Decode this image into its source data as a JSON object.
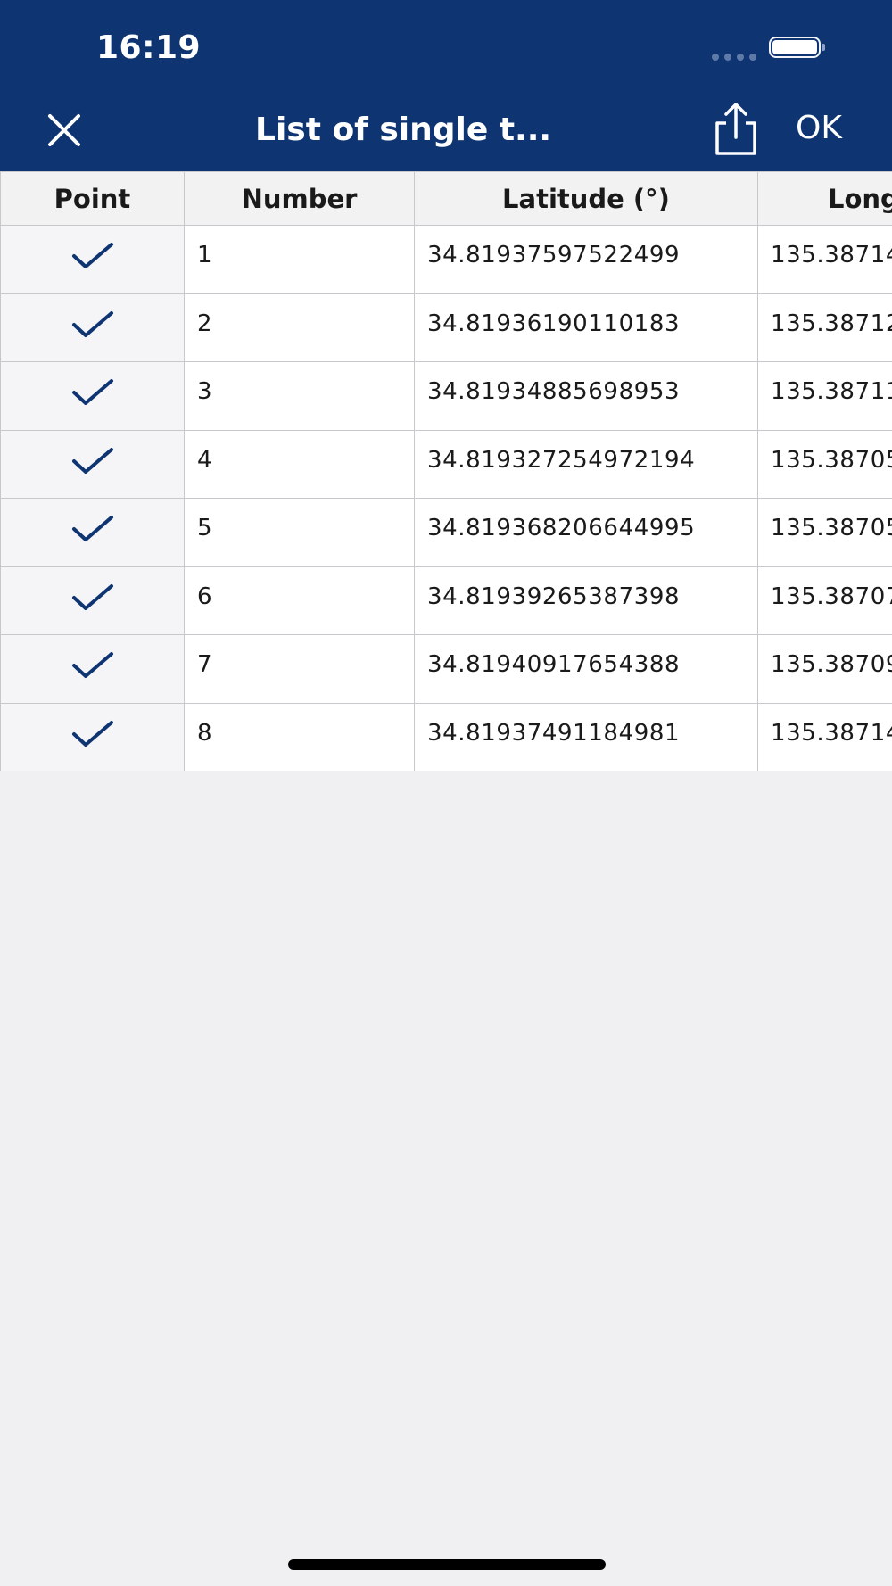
{
  "status_bar": {
    "time": "16:19"
  },
  "nav": {
    "title": "List of single t...",
    "ok_label": "OK",
    "close_icon": "close-icon",
    "share_icon": "share-icon"
  },
  "table": {
    "headers": {
      "point": "Point",
      "number": "Number",
      "latitude": "Latitude (°)",
      "longitude": "Long"
    },
    "rows": [
      {
        "checked": true,
        "number": "1",
        "latitude": "34.81937597522499",
        "longitude": "135.38714"
      },
      {
        "checked": true,
        "number": "2",
        "latitude": "34.81936190110183",
        "longitude": "135.38712"
      },
      {
        "checked": true,
        "number": "3",
        "latitude": "34.81934885698953",
        "longitude": "135.38711"
      },
      {
        "checked": true,
        "number": "4",
        "latitude": "34.819327254972194",
        "longitude": "135.38705"
      },
      {
        "checked": true,
        "number": "5",
        "latitude": "34.819368206644995",
        "longitude": "135.38705"
      },
      {
        "checked": true,
        "number": "6",
        "latitude": "34.81939265387398",
        "longitude": "135.38707"
      },
      {
        "checked": true,
        "number": "7",
        "latitude": "34.81940917654388",
        "longitude": "135.38709"
      },
      {
        "checked": true,
        "number": "8",
        "latitude": "34.81937491184981",
        "longitude": "135.38714"
      }
    ]
  },
  "colors": {
    "header_bg": "#0e3572",
    "check": "#0e3572",
    "page_bg": "#f0f0f3"
  }
}
